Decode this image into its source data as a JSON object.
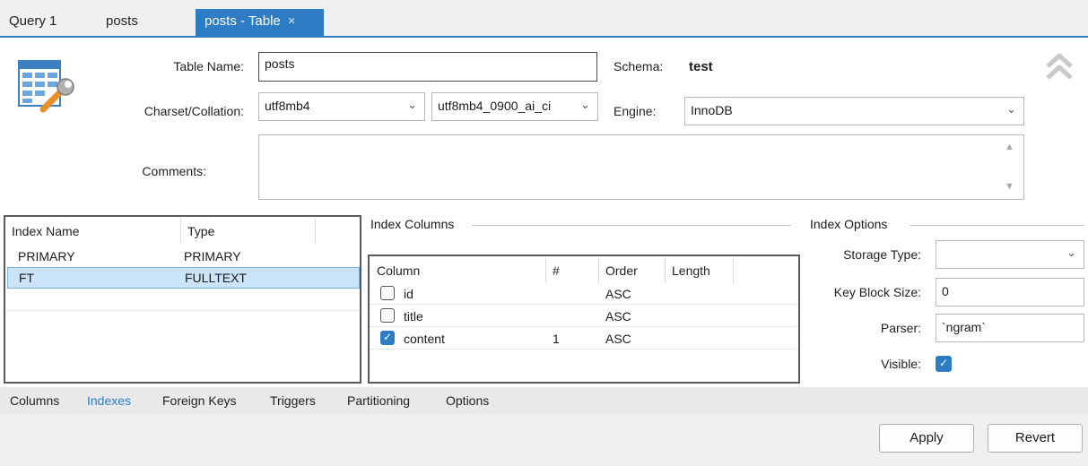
{
  "tabs": [
    {
      "label": "Query 1"
    },
    {
      "label": "posts"
    },
    {
      "label": "posts - Table",
      "active": true,
      "close": "×"
    }
  ],
  "form": {
    "table_name_label": "Table Name:",
    "table_name_value": "posts",
    "schema_label": "Schema:",
    "schema_value": "test",
    "charset_label": "Charset/Collation:",
    "charset_value": "utf8mb4",
    "collation_value": "utf8mb4_0900_ai_ci",
    "engine_label": "Engine:",
    "engine_value": "InnoDB",
    "comments_label": "Comments:",
    "comments_value": ""
  },
  "indexes": {
    "headers": [
      "Index Name",
      "Type"
    ],
    "rows": [
      {
        "name": "PRIMARY",
        "type": "PRIMARY",
        "selected": false
      },
      {
        "name": "FT",
        "type": "FULLTEXT",
        "selected": true
      }
    ]
  },
  "index_columns": {
    "title": "Index Columns",
    "headers": [
      "Column",
      "#",
      "Order",
      "Length"
    ],
    "rows": [
      {
        "column": "id",
        "checked": false,
        "num": "",
        "order": "ASC",
        "length": ""
      },
      {
        "column": "title",
        "checked": false,
        "num": "",
        "order": "ASC",
        "length": ""
      },
      {
        "column": "content",
        "checked": true,
        "num": "1",
        "order": "ASC",
        "length": ""
      }
    ]
  },
  "index_options": {
    "title": "Index Options",
    "storage_type_label": "Storage Type:",
    "storage_type_value": "",
    "key_block_label": "Key Block Size:",
    "key_block_value": "0",
    "parser_label": "Parser:",
    "parser_value": "`ngram`",
    "visible_label": "Visible:",
    "visible_checked": true
  },
  "subtabs": [
    "Columns",
    "Indexes",
    "Foreign Keys",
    "Triggers",
    "Partitioning",
    "Options"
  ],
  "subtab_active": "Indexes",
  "buttons": {
    "apply": "Apply",
    "revert": "Revert"
  },
  "colors": {
    "accent": "#2e7dc4",
    "selection": "#cce4f7"
  },
  "icons": {
    "table_editor": "table-wrench-icon",
    "collapse": "double-chevron-up-icon"
  }
}
